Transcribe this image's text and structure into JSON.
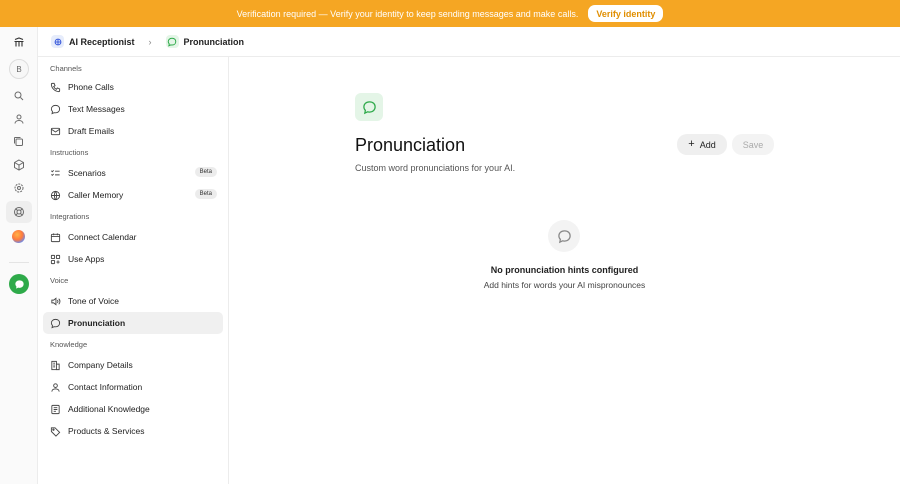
{
  "banner": {
    "message": "Verification required — Verify your identity to keep sending messages and make calls.",
    "button_label": "Verify identity"
  },
  "rail": {
    "avatar_initial": "B",
    "icons": [
      "logo-icon",
      "search-icon",
      "user-icon",
      "copy-icon",
      "cube-icon",
      "settings-icon",
      "help-icon",
      "orb-icon",
      "app-icon"
    ]
  },
  "breadcrumb": {
    "root_label": "AI Receptionist",
    "current_label": "Pronunciation"
  },
  "sidebar": {
    "sections": [
      {
        "title": "Channels",
        "items": [
          {
            "label": "Phone Calls",
            "icon": "phone-icon"
          },
          {
            "label": "Text Messages",
            "icon": "chat-icon"
          },
          {
            "label": "Draft Emails",
            "icon": "mail-icon"
          }
        ]
      },
      {
        "title": "Instructions",
        "items": [
          {
            "label": "Scenarios",
            "icon": "checklist-icon",
            "badge": "Beta"
          },
          {
            "label": "Caller Memory",
            "icon": "globe-icon",
            "badge": "Beta"
          }
        ]
      },
      {
        "title": "Integrations",
        "items": [
          {
            "label": "Connect Calendar",
            "icon": "calendar-icon"
          },
          {
            "label": "Use Apps",
            "icon": "apps-icon"
          }
        ]
      },
      {
        "title": "Voice",
        "items": [
          {
            "label": "Tone of Voice",
            "icon": "speaker-icon"
          },
          {
            "label": "Pronunciation",
            "icon": "chat-icon",
            "active": true
          }
        ]
      },
      {
        "title": "Knowledge",
        "items": [
          {
            "label": "Company Details",
            "icon": "building-icon"
          },
          {
            "label": "Contact Information",
            "icon": "contact-icon"
          },
          {
            "label": "Additional Knowledge",
            "icon": "book-icon"
          },
          {
            "label": "Products & Services",
            "icon": "tag-icon"
          }
        ]
      }
    ]
  },
  "main": {
    "title": "Pronunciation",
    "subtitle": "Custom word pronunciations for your AI.",
    "add_label": "Add",
    "save_label": "Save",
    "empty_title": "No pronunciation hints configured",
    "empty_subtitle": "Add hints for words your AI mispronounces"
  },
  "colors": {
    "banner": "#f5a623",
    "accent_green": "#2eaa4a",
    "icon_green_bg": "#e4f5e7"
  }
}
